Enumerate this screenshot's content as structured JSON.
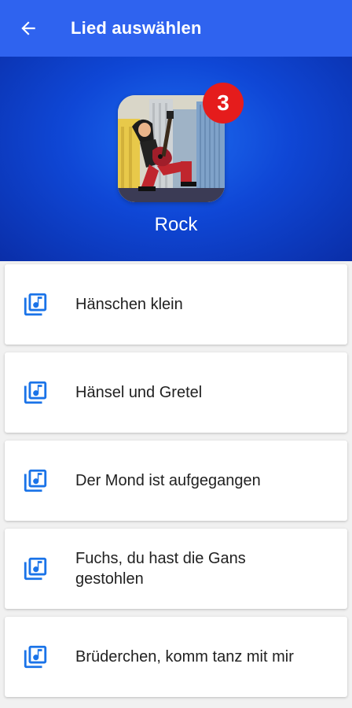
{
  "appbar": {
    "title": "Lied auswählen",
    "back_icon": "arrow-back-icon",
    "background": "#2f63ef"
  },
  "header": {
    "genre": "Rock",
    "badge_count": "3",
    "badge_color": "#e51c1c",
    "cover_image": "rock-guitarist-cover"
  },
  "songs": [
    {
      "label": "Hänschen klein",
      "icon": "music-library-icon"
    },
    {
      "label": "Hänsel und Gretel",
      "icon": "music-library-icon"
    },
    {
      "label": "Der Mond ist aufgegangen",
      "icon": "music-library-icon"
    },
    {
      "label": "Fuchs, du hast die Gans gestohlen",
      "icon": "music-library-icon"
    },
    {
      "label": "Brüderchen, komm tanz mit mir",
      "icon": "music-library-icon"
    }
  ],
  "colors": {
    "accent": "#1a73e8",
    "hero_center": "#1e6cf0",
    "hero_edge": "#0a2ea8"
  }
}
